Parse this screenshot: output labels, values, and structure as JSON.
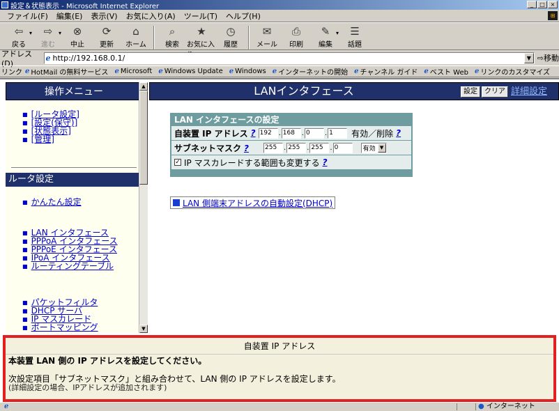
{
  "window": {
    "title": "設定＆状態表示 - Microsoft Internet Explorer"
  },
  "menubar": [
    "ファイル(F)",
    "編集(E)",
    "表示(V)",
    "お気に入り(A)",
    "ツール(T)",
    "ヘルプ(H)"
  ],
  "toolbar": {
    "buttons": [
      {
        "label": "戻る",
        "icon": "back-arrow"
      },
      {
        "label": "進む",
        "icon": "forward-arrow"
      },
      {
        "label": "中止",
        "icon": "stop-x"
      },
      {
        "label": "更新",
        "icon": "refresh"
      },
      {
        "label": "ホーム",
        "icon": "home"
      },
      {
        "label": "検索",
        "icon": "search"
      },
      {
        "label": "お気に入り",
        "icon": "favorites"
      },
      {
        "label": "履歴",
        "icon": "history"
      },
      {
        "label": "メール",
        "icon": "mail"
      },
      {
        "label": "印刷",
        "icon": "print"
      },
      {
        "label": "編集",
        "icon": "edit"
      },
      {
        "label": "話題",
        "icon": "discuss"
      }
    ]
  },
  "address": {
    "label": "アドレス(D)",
    "value": "http://192.168.0.1/",
    "go_label": "移動"
  },
  "links": {
    "label": "リンク",
    "items": [
      "HotMail の無料サービス",
      "Microsoft",
      "Windows Update",
      "Windows",
      "インターネットの開始",
      "チャンネル ガイド",
      "ベスト Web",
      "リンクのカスタマイズ"
    ]
  },
  "left": {
    "header": "操作メニュー",
    "top_links": [
      "[ルータ設定]",
      "[設定(保守)]",
      "[状態表示]",
      "[管理]"
    ],
    "section": "ルータ設定",
    "group1": [
      "かんたん設定"
    ],
    "group2": [
      "LAN インタフェース",
      "PPPoA インタフェース",
      "PPPoE インタフェース",
      "IPoA インタフェース",
      "ルーティングテーブル"
    ],
    "group3": [
      "パケットフィルタ",
      "DHCP サーバ",
      "IP マスカレード",
      "ポートマッピング"
    ]
  },
  "main": {
    "title": "LANインタフェース",
    "set_button": "設定",
    "clear_button": "クリア",
    "detail_link": "詳細設定",
    "box_title": "LAN インタフェースの設定",
    "ip_label": "自装置 IP アドレス",
    "ip_octets": [
      "192",
      "168",
      "0",
      "1"
    ],
    "enable_label": "有効／削除",
    "mask_label": "サブネットマスク",
    "mask_octets": [
      "255",
      "255",
      "255",
      "0"
    ],
    "enable_select": "有効",
    "masq_checkbox": "IP マスカレードする範囲も変更する",
    "help_mark": "?",
    "dhcp_link": "LAN 側端末アドレスの自動設定(DHCP)"
  },
  "help_panel": {
    "title": "自装置 IP アドレス",
    "subtitle": "本装置 LAN 側の IP アドレスを設定してください。",
    "body": "次設定項目「サブネットマスク」と組み合わせて、LAN 側の IP アドレスを設定します。",
    "body2": "(詳細設定の場合、IPアドレスが追加されます)"
  },
  "status": {
    "zone": "インターネット"
  },
  "colors": {
    "nav_header": "#20306a",
    "form_box": "#6f9c9e",
    "help_border": "#e22020",
    "help_bg": "#f3f0dd"
  }
}
